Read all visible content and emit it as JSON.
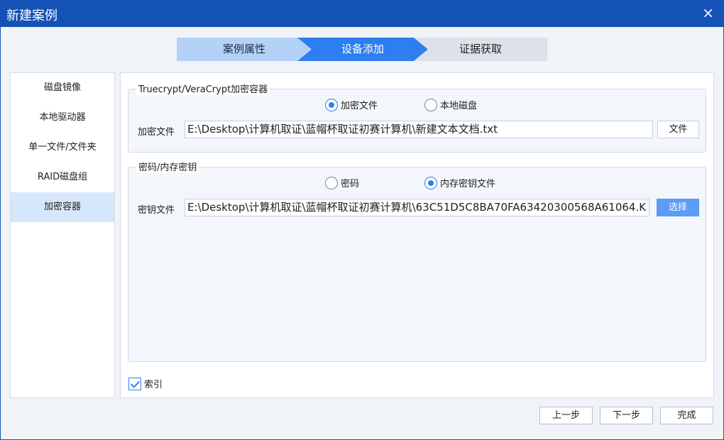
{
  "window": {
    "title": "新建案例",
    "close_icon": "×"
  },
  "steps": [
    "案例属性",
    "设备添加",
    "证据获取"
  ],
  "sidebar": {
    "items": [
      "磁盘镜像",
      "本地驱动器",
      "单一文件/文件夹",
      "RAID磁盘组",
      "加密容器"
    ],
    "active_index": 4
  },
  "container_group": {
    "legend": "Truecrypt/VeraCrypt加密容器",
    "radio_file": "加密文件",
    "radio_disk": "本地磁盘",
    "field_label": "加密文件",
    "field_value": "E:\\Desktop\\计算机取证\\蓝帽杯取证初赛计算机\\新建文本文档.txt",
    "button": "文件"
  },
  "key_group": {
    "legend": "密码/内存密钥",
    "radio_password": "密码",
    "radio_keyfile": "内存密钥文件",
    "field_label": "密钥文件",
    "field_value": "E:\\Desktop\\计算机取证\\蓝帽杯取证初赛计算机\\63C51D5C8BA70FA63420300568A61064.K",
    "button": "选择"
  },
  "index_checkbox": {
    "label": "索引",
    "checked": true
  },
  "footer": {
    "prev": "上一步",
    "next": "下一步",
    "finish": "完成"
  },
  "colors": {
    "title_bar": "#1452b8",
    "accent": "#2e7ef0",
    "active_step": "#2e7ef0",
    "done_step": "#b4d2f8"
  }
}
